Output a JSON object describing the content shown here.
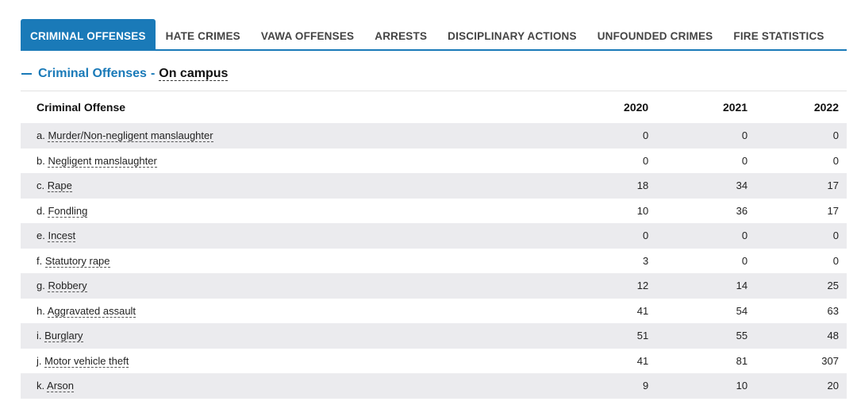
{
  "tabs": [
    {
      "label": "CRIMINAL OFFENSES",
      "active": true
    },
    {
      "label": "HATE CRIMES"
    },
    {
      "label": "VAWA OFFENSES"
    },
    {
      "label": "ARRESTS"
    },
    {
      "label": "DISCIPLINARY ACTIONS"
    },
    {
      "label": "UNFOUNDED CRIMES"
    },
    {
      "label": "FIRE STATISTICS"
    }
  ],
  "section": {
    "title": "Criminal Offenses",
    "separator": "-",
    "location": "On campus"
  },
  "table": {
    "headers": [
      "Criminal Offense",
      "2020",
      "2021",
      "2022"
    ],
    "rows": [
      {
        "prefix": "a.",
        "name": "Murder/Non-negligent manslaughter",
        "v2020": "0",
        "v2021": "0",
        "v2022": "0"
      },
      {
        "prefix": "b.",
        "name": "Negligent manslaughter",
        "v2020": "0",
        "v2021": "0",
        "v2022": "0"
      },
      {
        "prefix": "c.",
        "name": "Rape",
        "v2020": "18",
        "v2021": "34",
        "v2022": "17"
      },
      {
        "prefix": "d.",
        "name": "Fondling",
        "v2020": "10",
        "v2021": "36",
        "v2022": "17"
      },
      {
        "prefix": "e.",
        "name": "Incest",
        "v2020": "0",
        "v2021": "0",
        "v2022": "0"
      },
      {
        "prefix": "f.",
        "name": "Statutory rape",
        "v2020": "3",
        "v2021": "0",
        "v2022": "0"
      },
      {
        "prefix": "g.",
        "name": "Robbery",
        "v2020": "12",
        "v2021": "14",
        "v2022": "25"
      },
      {
        "prefix": "h.",
        "name": "Aggravated assault",
        "v2020": "41",
        "v2021": "54",
        "v2022": "63"
      },
      {
        "prefix": "i.",
        "name": "Burglary",
        "v2020": "51",
        "v2021": "55",
        "v2022": "48"
      },
      {
        "prefix": "j.",
        "name": "Motor vehicle theft",
        "v2020": "41",
        "v2021": "81",
        "v2022": "307"
      },
      {
        "prefix": "k.",
        "name": "Arson",
        "v2020": "9",
        "v2021": "10",
        "v2022": "20"
      }
    ]
  },
  "colors": {
    "accent": "#1a7ab8",
    "stripe": "#ebebee"
  }
}
